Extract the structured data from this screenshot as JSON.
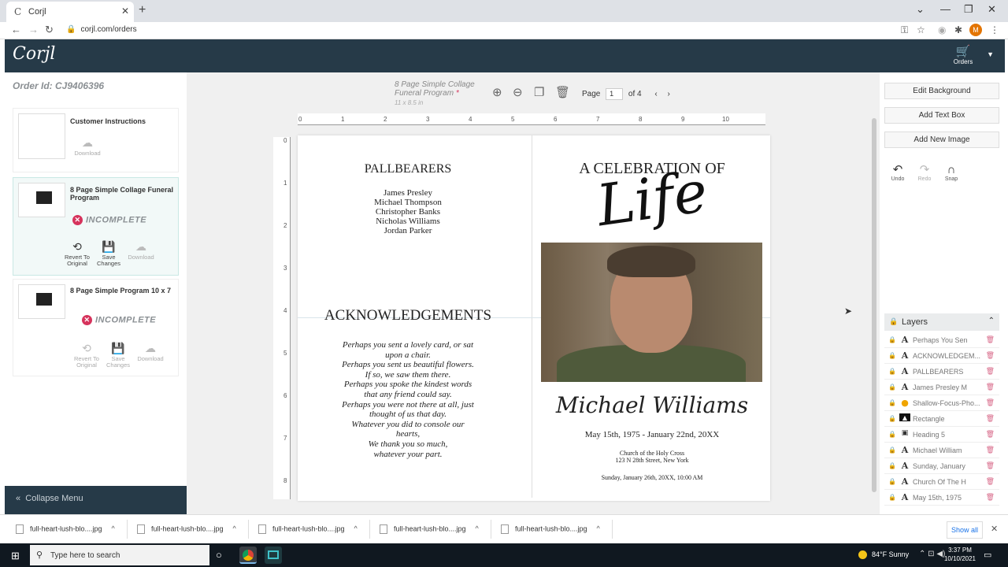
{
  "browser": {
    "tab_title": "Corjl",
    "favicon": "C",
    "url": "corjl.com/orders",
    "avatar_letter": "M"
  },
  "app": {
    "logo": "Corjl",
    "orders_label": "Orders"
  },
  "left_panel": {
    "order_id": "Order Id: CJ9406396",
    "customer_instructions": {
      "title": "Customer Instructions",
      "download": "Download"
    },
    "items": [
      {
        "title": "8 Page Simple Collage Funeral Program",
        "status": "INCOMPLETE",
        "revert": "Revert To Original",
        "save": "Save Changes",
        "download": "Download"
      },
      {
        "title": "8 Page Simple Program 10 x 7",
        "status": "INCOMPLETE",
        "revert": "Revert To Original",
        "save": "Save Changes",
        "download": "Download"
      }
    ],
    "collapse_menu": "Collapse Menu"
  },
  "toolbar": {
    "doc_title_line1": "8 Page Simple Collage",
    "doc_title_line2": "Funeral Program",
    "doc_size": "11 x 8.5 in",
    "page_label": "Page",
    "page_current": "1",
    "page_of": "of 4"
  },
  "ruler": {
    "h_numbers": [
      "0",
      "1",
      "2",
      "3",
      "4",
      "5",
      "6",
      "7",
      "8",
      "9",
      "10"
    ],
    "v_numbers": [
      "0",
      "1",
      "2",
      "3",
      "4",
      "5",
      "6",
      "7",
      "8"
    ]
  },
  "document": {
    "pallbearers_heading": "PALLBEARERS",
    "pallbearers": [
      "James Presley",
      "Michael Thompson",
      "Christopher Banks",
      "Nicholas Williams",
      "Jordan Parker"
    ],
    "ack_heading": "ACKNOWLEDGEMENTS",
    "poem": [
      "Perhaps you sent a lovely card, or sat",
      "upon a chair.",
      "Perhaps you sent us beautiful flowers.",
      "If so, we saw them there.",
      "Perhaps you spoke the kindest words",
      "that any friend could say.",
      "Perhaps you were not there at all, just",
      "thought of us that day.",
      "Whatever you did to console our",
      "hearts,",
      "We thank you so much,",
      "whatever your part."
    ],
    "celebration": "A CELEBRATION OF",
    "life_script": "Life",
    "name": "Michael Williams",
    "dates": "May 15th, 1975 - January 22nd, 20XX",
    "church_line1": "Church of the Holy Cross",
    "church_line2": "123 N 28th Street, New York",
    "service": "Sunday, January 26th, 20XX, 10:00 AM"
  },
  "right_panel": {
    "edit_background": "Edit Background",
    "add_text_box": "Add Text Box",
    "add_new_image": "Add New Image",
    "undo": "Undo",
    "redo": "Redo",
    "snap": "Snap",
    "layers_title": "Layers",
    "layers": [
      {
        "type": "text",
        "name": "Perhaps You Sen"
      },
      {
        "type": "text",
        "name": "ACKNOWLEDGEM..."
      },
      {
        "type": "text",
        "name": "PALLBEARERS"
      },
      {
        "type": "text",
        "name": "James Presley M"
      },
      {
        "type": "image-warning",
        "name": "Shallow-Focus-Pho..."
      },
      {
        "type": "shape",
        "name": "Rectangle"
      },
      {
        "type": "image",
        "name": "Heading 5"
      },
      {
        "type": "text",
        "name": "Michael William"
      },
      {
        "type": "text",
        "name": "Sunday, January"
      },
      {
        "type": "text",
        "name": "Church Of The H"
      },
      {
        "type": "text",
        "name": "May 15th, 1975"
      }
    ]
  },
  "downloads": {
    "files": [
      "full-heart-lush-blo....jpg",
      "full-heart-lush-blo....jpg",
      "full-heart-lush-blo....jpg",
      "full-heart-lush-blo....jpg",
      "full-heart-lush-blo....jpg"
    ],
    "show_all": "Show all"
  },
  "taskbar": {
    "search_placeholder": "Type here to search",
    "weather": "84°F  Sunny",
    "time": "3:37 PM",
    "date": "10/10/2021"
  },
  "colors": {
    "header": "#263a48",
    "incomplete": "#d6335c",
    "active_card": "#f2f9f8"
  }
}
